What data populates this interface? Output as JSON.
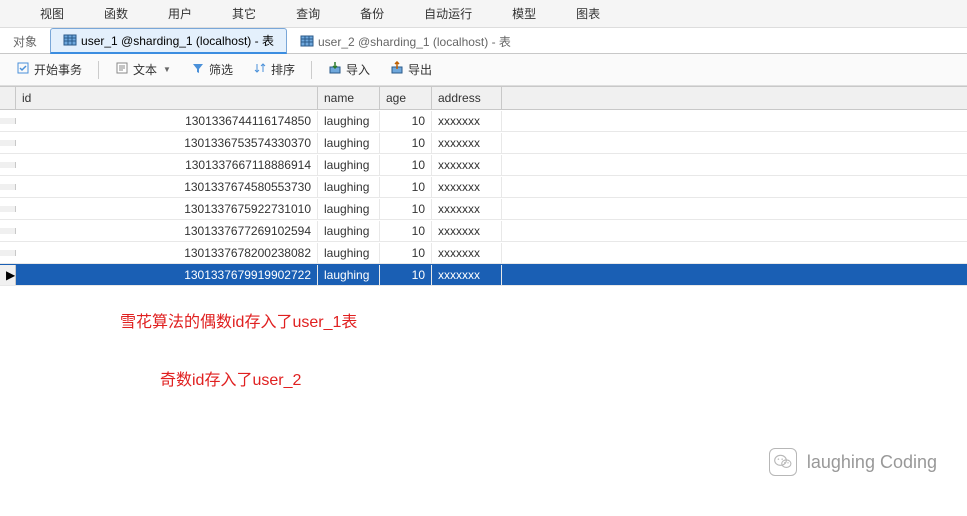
{
  "menu": {
    "items": [
      "视图",
      "函数",
      "用户",
      "其它",
      "查询",
      "备份",
      "自动运行",
      "模型",
      "图表"
    ]
  },
  "tabs": {
    "obj_label": "对象",
    "tab1_label": "user_1 @sharding_1 (localhost) - 表",
    "tab2_label": "user_2 @sharding_1 (localhost) - 表"
  },
  "toolbar": {
    "begin_tx": "开始事务",
    "text": "文本",
    "filter": "筛选",
    "sort": "排序",
    "import": "导入",
    "export": "导出"
  },
  "columns": {
    "id": "id",
    "name": "name",
    "age": "age",
    "address": "address"
  },
  "rows": [
    {
      "id": "1301336744116174850",
      "name": "laughing",
      "age": "10",
      "address": "xxxxxxx"
    },
    {
      "id": "1301336753574330370",
      "name": "laughing",
      "age": "10",
      "address": "xxxxxxx"
    },
    {
      "id": "1301337667118886914",
      "name": "laughing",
      "age": "10",
      "address": "xxxxxxx"
    },
    {
      "id": "1301337674580553730",
      "name": "laughing",
      "age": "10",
      "address": "xxxxxxx"
    },
    {
      "id": "1301337675922731010",
      "name": "laughing",
      "age": "10",
      "address": "xxxxxxx"
    },
    {
      "id": "1301337677269102594",
      "name": "laughing",
      "age": "10",
      "address": "xxxxxxx"
    },
    {
      "id": "1301337678200238082",
      "name": "laughing",
      "age": "10",
      "address": "xxxxxxx"
    },
    {
      "id": "1301337679919902722",
      "name": "laughing",
      "age": "10",
      "address": "xxxxxxx"
    }
  ],
  "selected_row_index": 7,
  "annotation1": "雪花算法的偶数id存入了user_1表",
  "annotation2": "奇数id存入了user_2",
  "watermark": "laughing Coding"
}
